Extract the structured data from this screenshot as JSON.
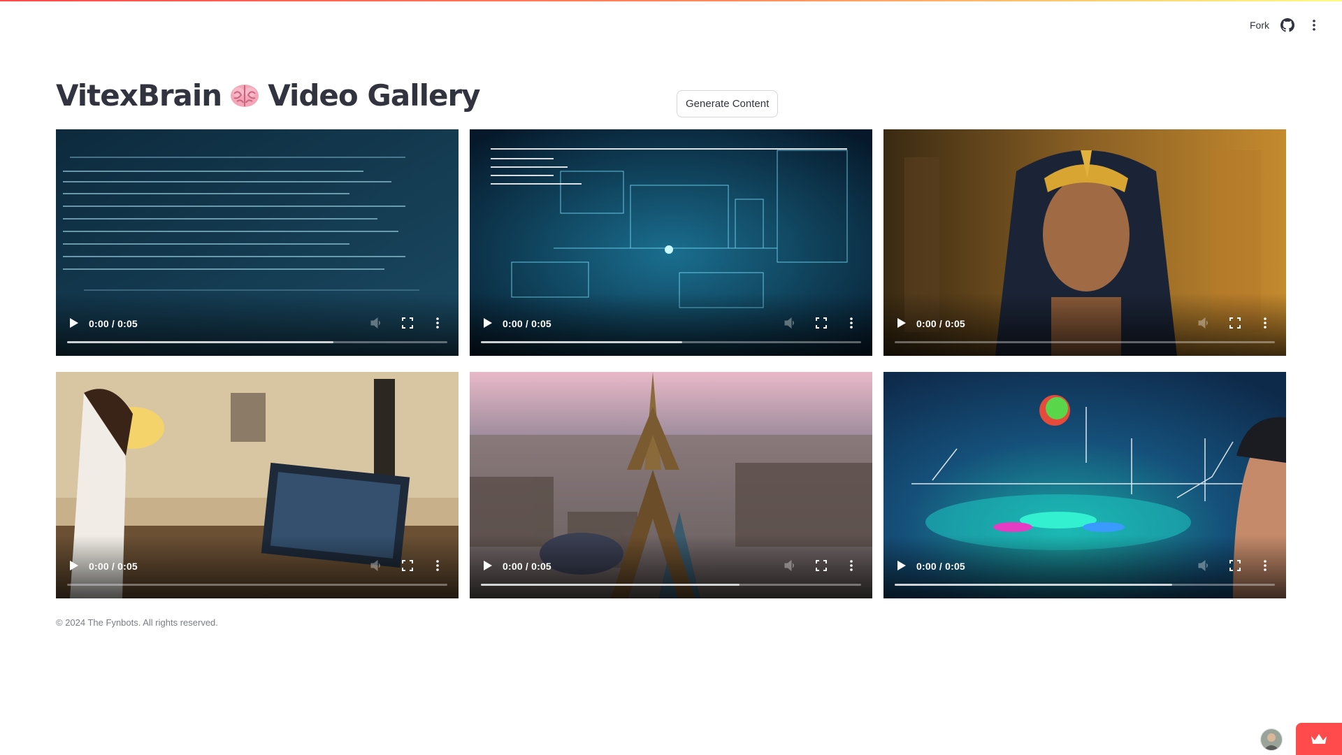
{
  "app": {
    "title": "VitexBrain",
    "title_suffix": "Video Gallery",
    "title_icon": "brain-emoji",
    "accent": "#ff4b4b"
  },
  "toolbar": {
    "fork_label": "Fork",
    "github_icon": "github-icon",
    "menu_icon": "kebab-menu-icon"
  },
  "actions": {
    "generate_label": "Generate Content"
  },
  "videos": [
    {
      "time": "0:00 / 0:05",
      "thumbnail": "data-text-screen",
      "buffered": 0.7
    },
    {
      "time": "0:00 / 0:05",
      "thumbnail": "holographic-blueprint",
      "buffered": 0.53
    },
    {
      "time": "0:00 / 0:05",
      "thumbnail": "egyptian-queen",
      "buffered": 0
    },
    {
      "time": "0:00 / 0:05",
      "thumbnail": "woman-at-computer",
      "buffered": 0
    },
    {
      "time": "0:00 / 0:05",
      "thumbnail": "paris-eiffel-tower",
      "buffered": 0.68
    },
    {
      "time": "0:00 / 0:05",
      "thumbnail": "science-hologram",
      "buffered": 0.73
    }
  ],
  "footer": {
    "text": "© 2024 The Fynbots. All rights reserved."
  },
  "corner": {
    "avatar_icon": "user-avatar",
    "deploy_icon": "streamlit-crown-icon"
  }
}
